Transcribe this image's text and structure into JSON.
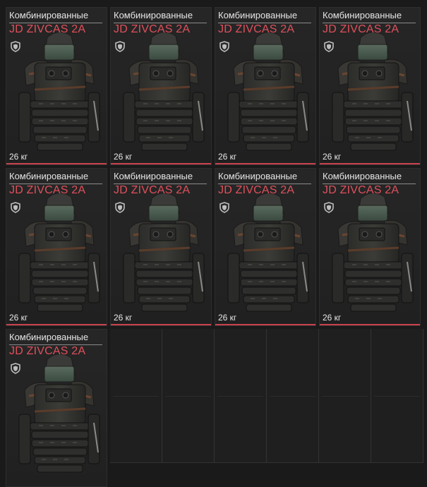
{
  "items": [
    {
      "category": "Комбинированные",
      "name": "JD ZIVCAS 2A",
      "weight": "26 кг",
      "icon": "shield-icon"
    },
    {
      "category": "Комбинированные",
      "name": "JD ZIVCAS 2A",
      "weight": "26 кг",
      "icon": "shield-icon"
    },
    {
      "category": "Комбинированные",
      "name": "JD ZIVCAS 2A",
      "weight": "26 кг",
      "icon": "shield-icon"
    },
    {
      "category": "Комбинированные",
      "name": "JD ZIVCAS 2A",
      "weight": "26 кг",
      "icon": "shield-icon"
    },
    {
      "category": "Комбинированные",
      "name": "JD ZIVCAS 2A",
      "weight": "26 кг",
      "icon": "shield-icon"
    },
    {
      "category": "Комбинированные",
      "name": "JD ZIVCAS 2A",
      "weight": "26 кг",
      "icon": "shield-icon"
    },
    {
      "category": "Комбинированные",
      "name": "JD ZIVCAS 2A",
      "weight": "26 кг",
      "icon": "shield-icon"
    },
    {
      "category": "Комбинированные",
      "name": "JD ZIVCAS 2A",
      "weight": "26 кг",
      "icon": "shield-icon"
    },
    {
      "category": "Комбинированные",
      "name": "JD ZIVCAS 2A",
      "weight": "",
      "icon": "shield-icon"
    }
  ],
  "colors": {
    "accent": "#e0505c",
    "text": "#e6e6e6",
    "background": "#1a1a1a"
  }
}
